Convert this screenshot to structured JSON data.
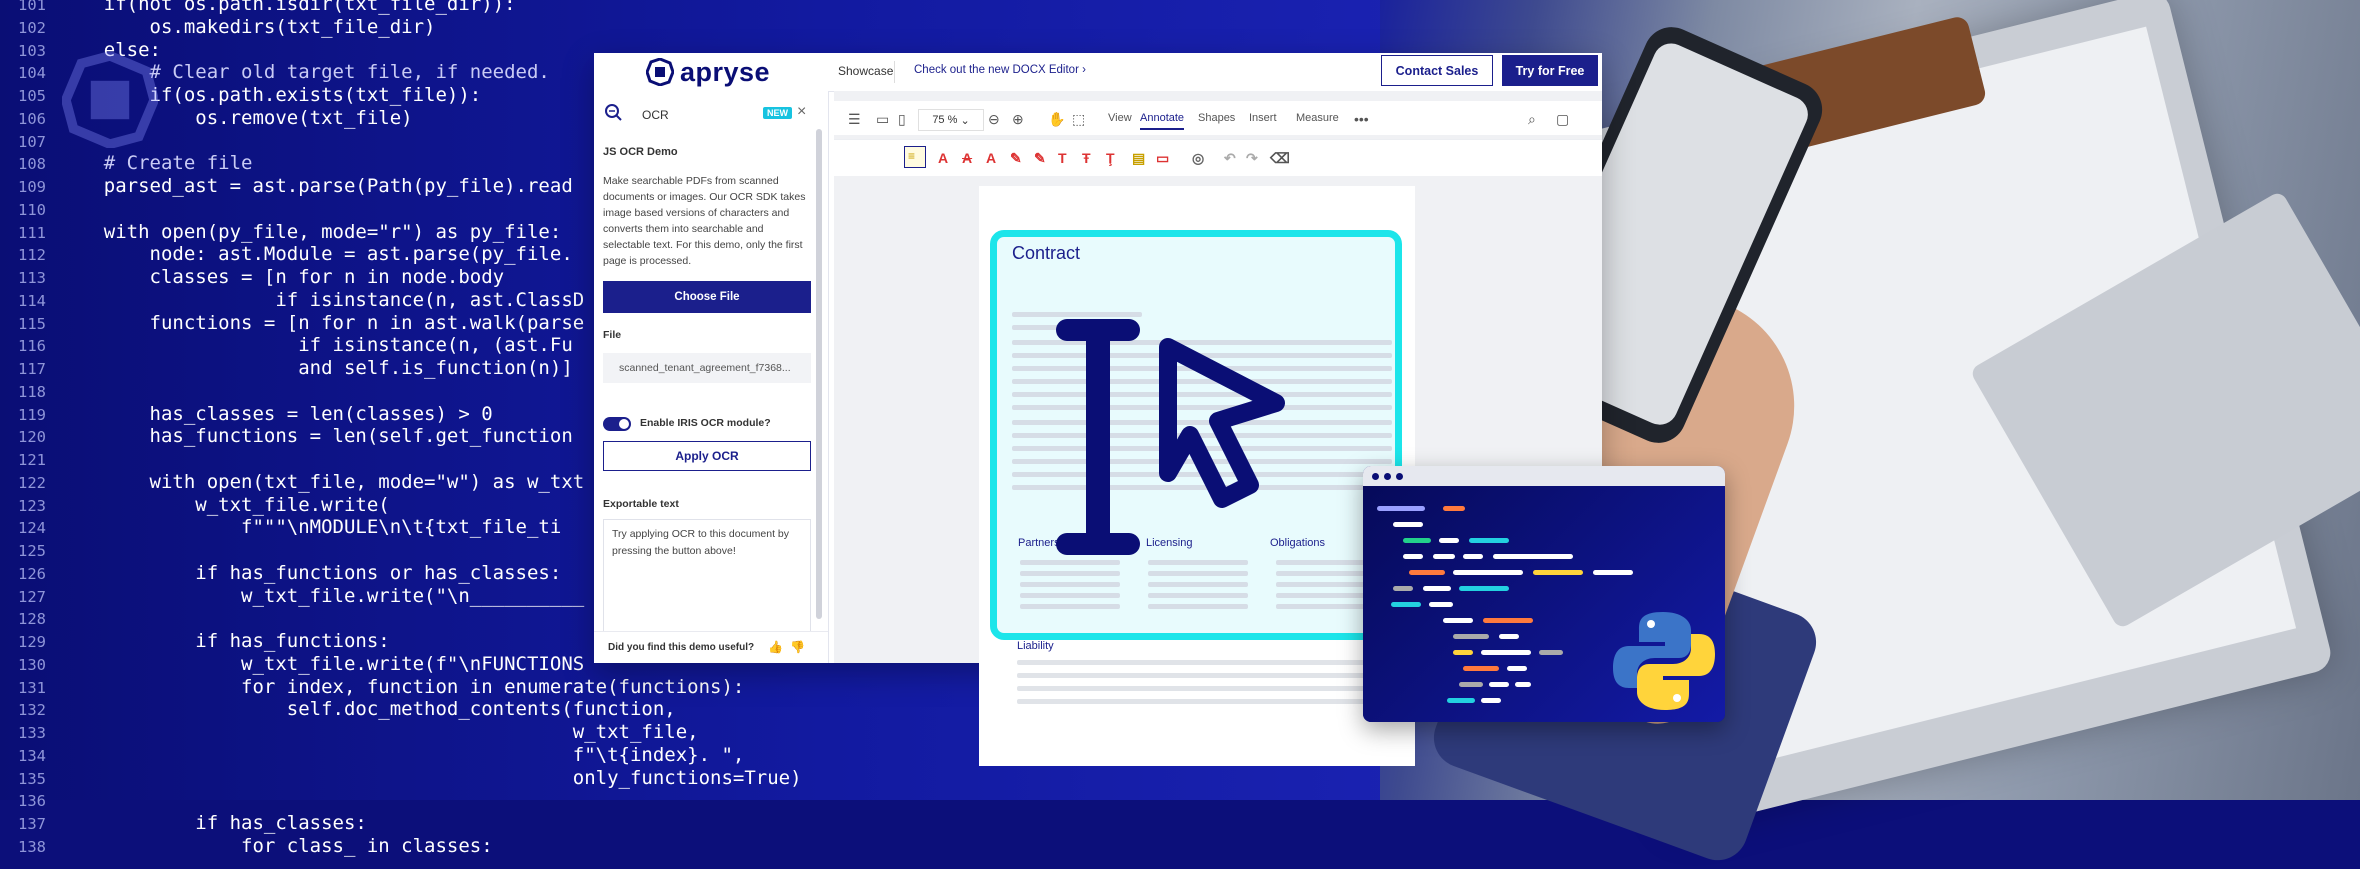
{
  "code": {
    "lines": [
      {
        "n": "101",
        "t": "    if(not os.path.isdir(txt_file_dir)):"
      },
      {
        "n": "102",
        "t": "        os.makedirs(txt_file_dir)"
      },
      {
        "n": "103",
        "t": "    else:"
      },
      {
        "n": "104",
        "t": "        # Clear old target file, if needed."
      },
      {
        "n": "105",
        "t": "        if(os.path.exists(txt_file)):"
      },
      {
        "n": "106",
        "t": "            os.remove(txt_file)"
      },
      {
        "n": "107",
        "t": ""
      },
      {
        "n": "108",
        "t": "    # Create file"
      },
      {
        "n": "109",
        "t": "    parsed_ast = ast.parse(Path(py_file).read"
      },
      {
        "n": "110",
        "t": ""
      },
      {
        "n": "111",
        "t": "    with open(py_file, mode=\"r\") as py_file:"
      },
      {
        "n": "112",
        "t": "        node: ast.Module = ast.parse(py_file."
      },
      {
        "n": "113",
        "t": "        classes = [n for n in node.body"
      },
      {
        "n": "114",
        "t": "                   if isinstance(n, ast.ClassD"
      },
      {
        "n": "115",
        "t": "        functions = [n for n in ast.walk(parse"
      },
      {
        "n": "116",
        "t": "                     if isinstance(n, (ast.Fu"
      },
      {
        "n": "117",
        "t": "                     and self.is_function(n)]"
      },
      {
        "n": "118",
        "t": ""
      },
      {
        "n": "119",
        "t": "        has_classes = len(classes) > 0"
      },
      {
        "n": "120",
        "t": "        has_functions = len(self.get_function"
      },
      {
        "n": "121",
        "t": ""
      },
      {
        "n": "122",
        "t": "        with open(txt_file, mode=\"w\") as w_txt"
      },
      {
        "n": "123",
        "t": "            w_txt_file.write("
      },
      {
        "n": "124",
        "t": "                f\"\"\"\\nMODULE\\n\\t{txt_file_ti"
      },
      {
        "n": "125",
        "t": ""
      },
      {
        "n": "126",
        "t": "            if has_functions or has_classes:"
      },
      {
        "n": "127",
        "t": "                w_txt_file.write(\"\\n__________"
      },
      {
        "n": "128",
        "t": ""
      },
      {
        "n": "129",
        "t": "            if has_functions:"
      },
      {
        "n": "130",
        "t": "                w_txt_file.write(f\"\\nFUNCTIONS"
      },
      {
        "n": "131",
        "t": "                for index, function in enumerate(functions):"
      },
      {
        "n": "132",
        "t": "                    self.doc_method_contents(function,"
      },
      {
        "n": "133",
        "t": "                                             w_txt_file,"
      },
      {
        "n": "134",
        "t": "                                             f\"\\t{index}. \","
      },
      {
        "n": "135",
        "t": "                                             only_functions=True)"
      },
      {
        "n": "136",
        "t": ""
      },
      {
        "n": "137",
        "t": "            if has_classes:"
      },
      {
        "n": "138",
        "t": "                for class_ in classes:"
      }
    ]
  },
  "header": {
    "logo_text": "apryse",
    "showcase": "Showcase",
    "docx_link": "Check out the new DOCX Editor",
    "contact_sales": "Contact Sales",
    "try_free": "Try for Free"
  },
  "panel": {
    "title": "OCR",
    "badge": "NEW",
    "demo_title": "JS OCR Demo",
    "description": "Make searchable PDFs from scanned documents or images. Our OCR SDK takes image based versions of characters and converts them into searchable and selectable text. For this demo, only the first page is processed.",
    "choose_file": "Choose File",
    "file_label": "File",
    "file_name": "scanned_tenant_agreement_f7368...",
    "toggle_label": "Enable IRIS OCR module?",
    "toggle_on": true,
    "apply_ocr": "Apply OCR",
    "export_label": "Exportable text",
    "export_placeholder": "Try applying OCR to this document by pressing the button above!",
    "feedback": "Did you find this demo useful?"
  },
  "viewer": {
    "zoom": "75 %",
    "tabs": [
      "View",
      "Annotate",
      "Shapes",
      "Insert",
      "Measure"
    ],
    "active_tab": "Annotate"
  },
  "document": {
    "title": "Contract",
    "sections": [
      "Partners",
      "Licensing",
      "Obligations"
    ],
    "liability": "Liability"
  },
  "colors": {
    "brand": "#1b1f8c",
    "accent": "#1ce5ea",
    "bg": "#0c0f7a"
  }
}
